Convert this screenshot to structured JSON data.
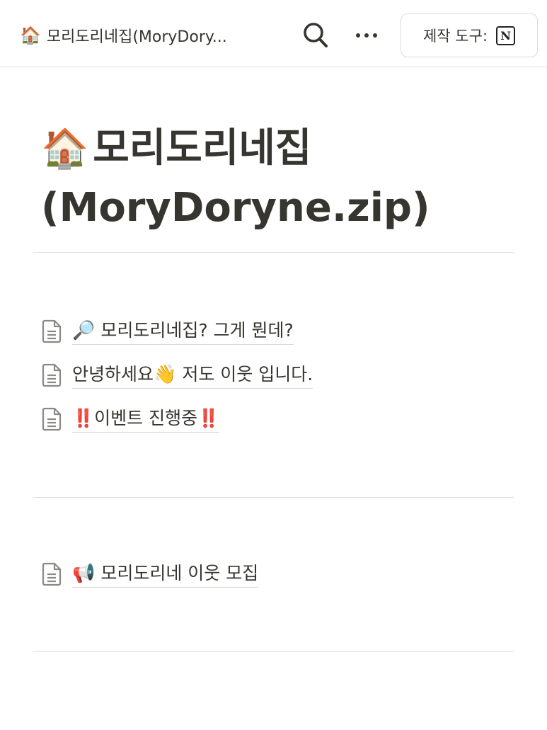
{
  "topbar": {
    "breadcrumb_emoji": "🏠",
    "breadcrumb_text": "모리도리네집(MoryDory...",
    "search_icon": "search-icon",
    "more_icon": "more-horizontal-icon",
    "builder_label": "제작 도구:",
    "builder_logo_letter": "N"
  },
  "page": {
    "title_emoji": "🏠",
    "title_line1": "모리도리네집",
    "title_line2": "(MoryDoryne.zip)"
  },
  "links": [
    {
      "emoji": "🔎",
      "text": "모리도리네집? 그게 뭔데?"
    },
    {
      "text_before": "안녕하세요",
      "emoji": "👋",
      "text_after": " 저도 이웃 입니다."
    },
    {
      "prefix": "‼️",
      "text": "이벤트 진행중",
      "suffix": "‼️"
    },
    {
      "emoji": "📢",
      "text": "모리도리네 이웃 모집"
    }
  ],
  "colors": {
    "text": "#37352f",
    "divider": "#e1e0de",
    "accent_red": "#d4302c"
  }
}
